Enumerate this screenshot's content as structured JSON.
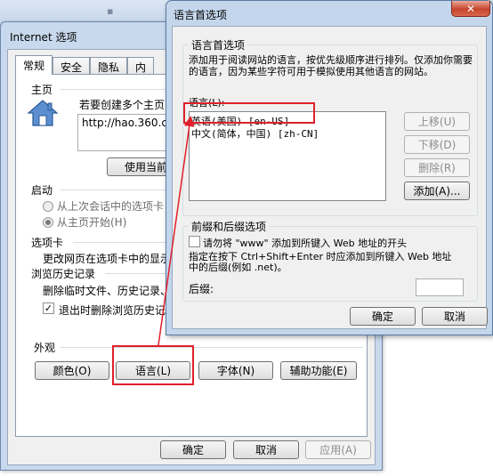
{
  "ie_window": {
    "title": "Internet 选项",
    "tabs": [
      "常规",
      "安全",
      "隐私",
      "内"
    ],
    "home": {
      "label": "主页",
      "desc": "若要创建多个主页",
      "url": "http://hao.360.c",
      "use_current": "使用当前页"
    },
    "startup": {
      "label": "启动",
      "opt_last": "从上次会话中的选项卡",
      "opt_home": "从主页开始(H)"
    },
    "tabs_section": {
      "label": "选项卡",
      "desc": "更改网页在选项卡中的显示"
    },
    "history": {
      "label": "浏览历史记录",
      "desc": "删除临时文件、历史记录、",
      "exit_delete": "退出时删除浏览历史记"
    },
    "appearance": {
      "label": "外观",
      "colors": "颜色(O)",
      "languages": "语言(L)",
      "fonts": "字体(N)",
      "accessibility": "辅助功能(E)"
    },
    "ok": "确定",
    "cancel": "取消",
    "apply": "应用(A)"
  },
  "lang_dialog": {
    "title": "语言首选项",
    "group_title": "语言首选项",
    "desc": "添加用于阅读网站的语言，按优先级顺序进行排列。仅添加你需要的语言，因为某些字符可用于模拟使用其他语言的网站。",
    "lang_label": "语言(L):",
    "languages": [
      "英语(美国) [en-US]",
      "中文(简体，中国) [zh-CN]"
    ],
    "move_up": "上移(U)",
    "move_down": "下移(D)",
    "remove": "删除(R)",
    "add": "添加(A)...",
    "prefix_group": "前缀和后缀选项",
    "prefix_opt1": "请勿将 \"www\" 添加到所键入 Web 地址的开头",
    "prefix_opt2": "指定在按下 Ctrl+Shift+Enter 时应添加到所键入 Web 地址中的后缀(例如 .net)。",
    "suffix_label": "后缀:",
    "ok": "确定",
    "cancel": "取消"
  },
  "icons": {
    "home": "house-icon",
    "close": "close-icon",
    "check": "checkmark-icon"
  },
  "colors": {
    "highlight": "#e0202a",
    "title_bar": "#c4d6ec"
  }
}
